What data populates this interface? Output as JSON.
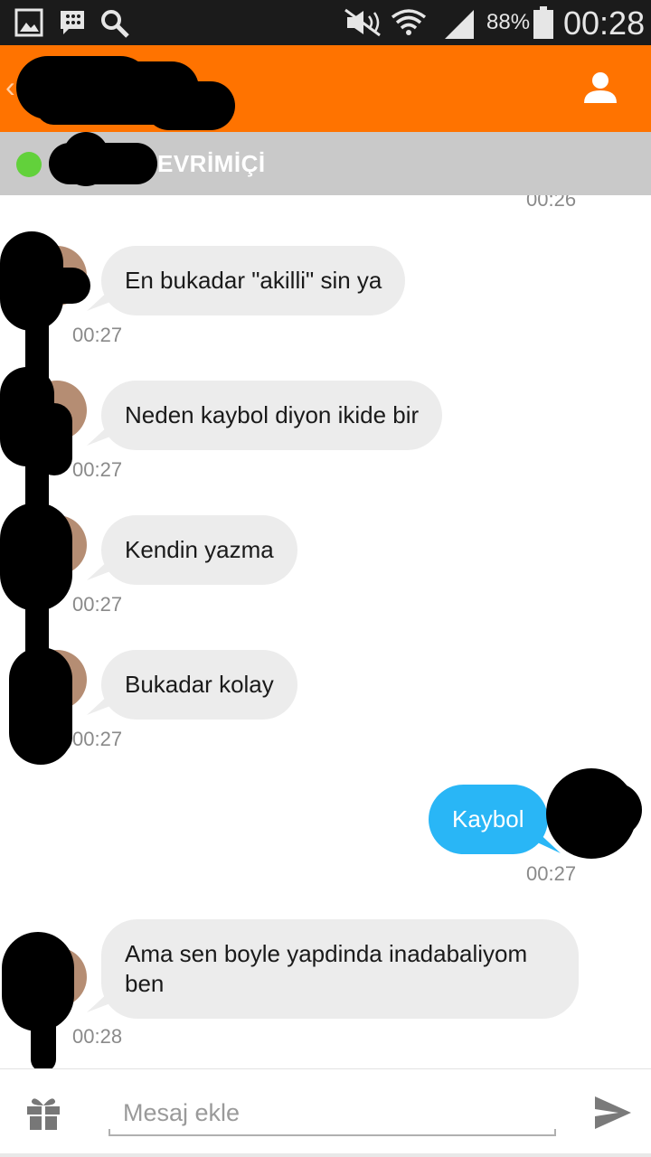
{
  "status_bar": {
    "icons": [
      "gallery-icon",
      "bbm-icon",
      "search-icon",
      "mute-icon",
      "wifi-icon",
      "signal-icon",
      "battery-icon"
    ],
    "battery_percent": "88%",
    "clock": "00:28"
  },
  "header": {
    "back_icon": "chevron-left-icon",
    "profile_icon": "person-icon",
    "accent_color": "#ff7300"
  },
  "presence": {
    "status_text": "EVRİMİÇİ",
    "status_color": "#62d13b"
  },
  "messages": [
    {
      "direction": "in",
      "text": "",
      "time": "00:26"
    },
    {
      "direction": "in",
      "text": "En bukadar \"akilli\" sin ya",
      "time": "00:27"
    },
    {
      "direction": "in",
      "text": "Neden kaybol diyon ikide bir",
      "time": "00:27"
    },
    {
      "direction": "in",
      "text": "Kendin yazma",
      "time": "00:27"
    },
    {
      "direction": "in",
      "text": "Bukadar kolay",
      "time": "00:27"
    },
    {
      "direction": "out",
      "text": "Kaybol",
      "time": "00:27"
    },
    {
      "direction": "in",
      "text": "Ama sen boyle yapdinda inadabaliyom ben",
      "time": "00:28"
    }
  ],
  "composer": {
    "placeholder": "Mesaj ekle",
    "gift_icon": "gift-icon",
    "send_icon": "send-icon"
  },
  "colors": {
    "incoming_bubble": "#ececec",
    "outgoing_bubble": "#29b6f6"
  }
}
